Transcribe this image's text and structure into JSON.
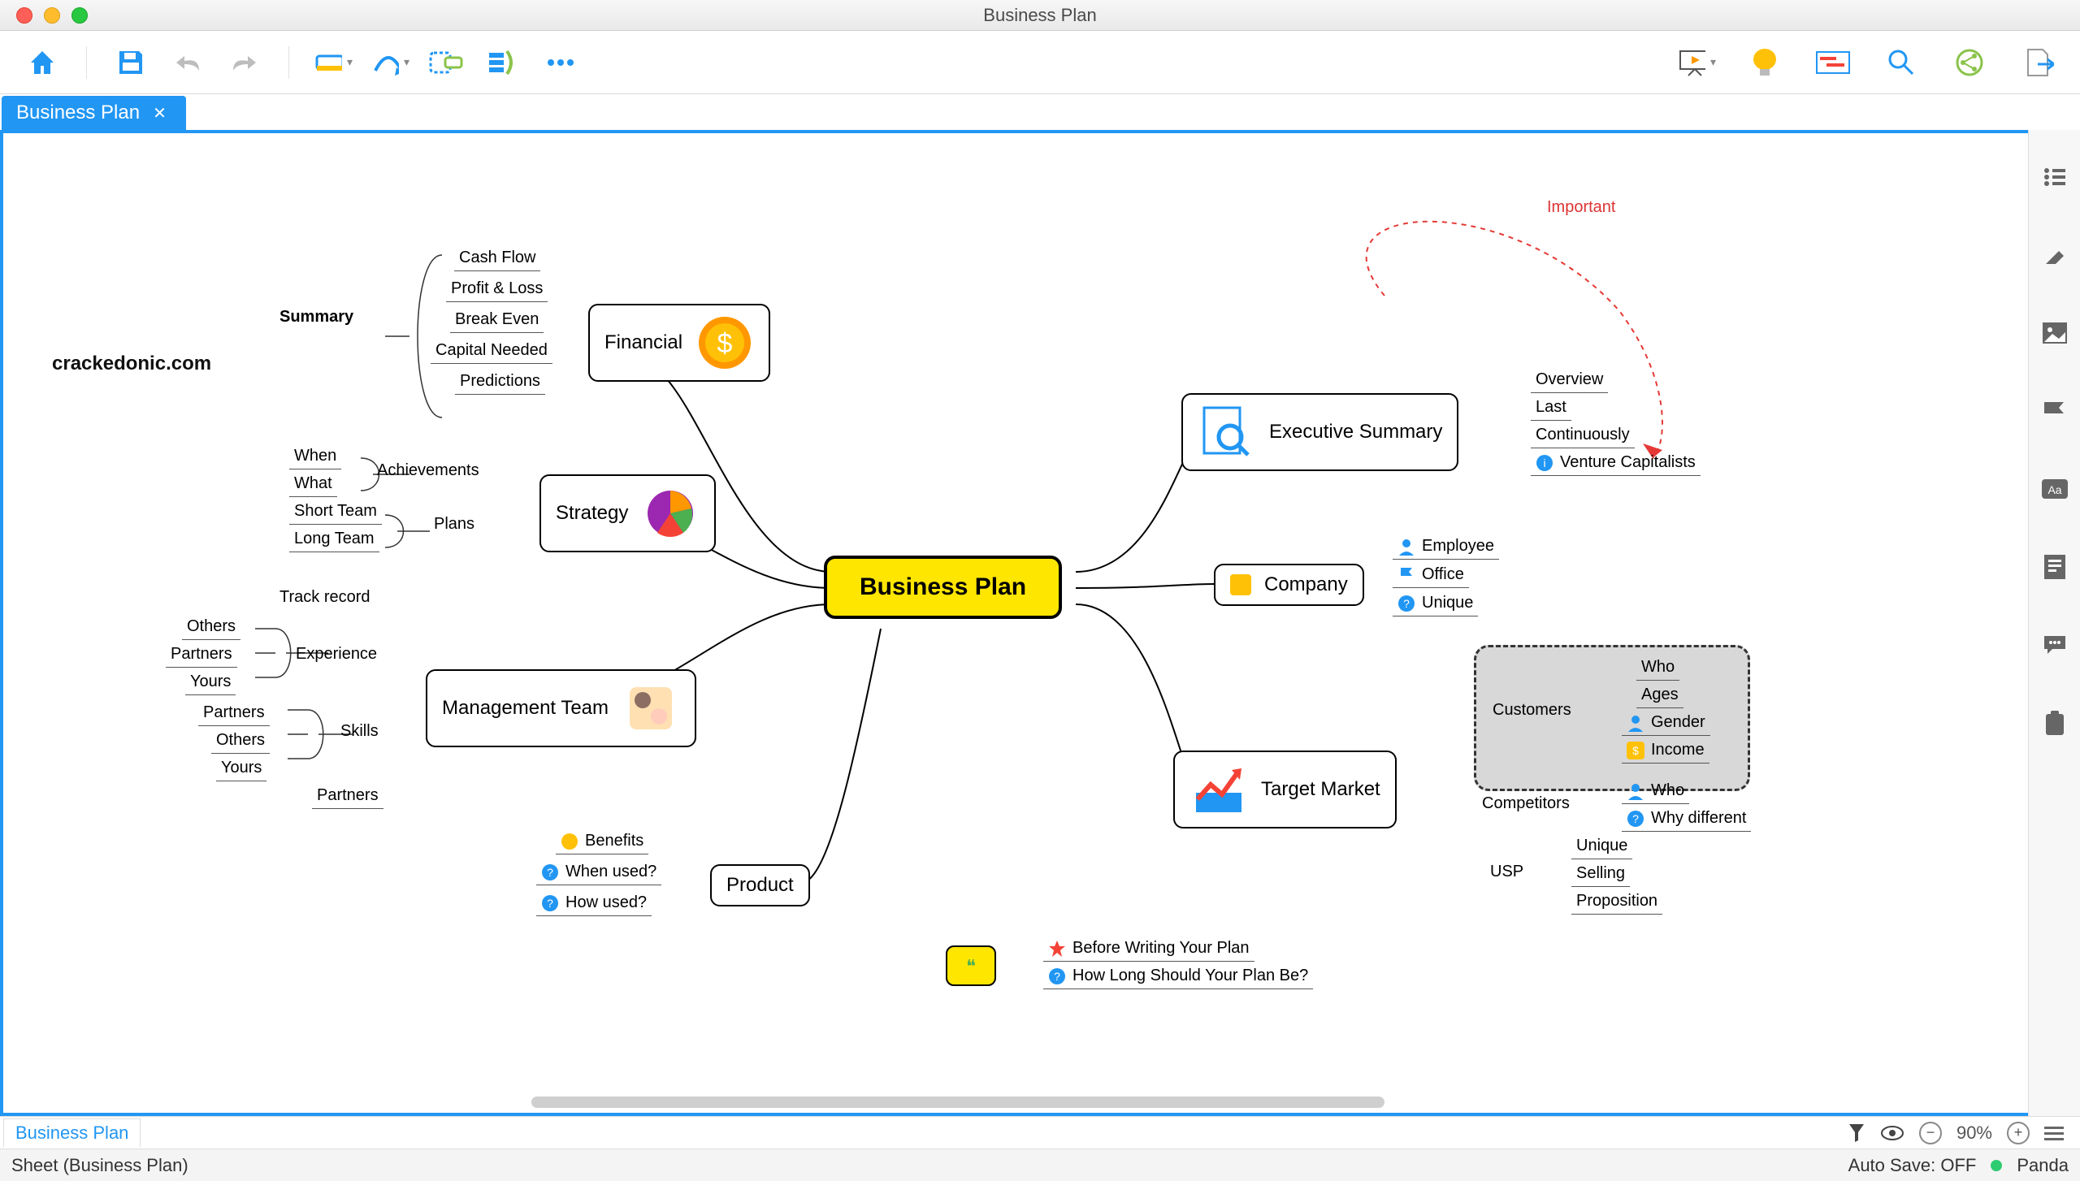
{
  "window": {
    "title": "Business Plan"
  },
  "tab": {
    "label": "Business Plan"
  },
  "sheet_tab": "Business Plan",
  "status": {
    "sheet": "Sheet (Business Plan)",
    "autosave": "Auto Save: OFF",
    "user": "Panda"
  },
  "zoom": {
    "pct": "90%"
  },
  "watermark": "crackedonic.com",
  "callout": "Important",
  "central": "Business Plan",
  "nodes": {
    "financial": "Financial",
    "strategy": "Strategy",
    "management": "Management Team",
    "product": "Product",
    "exec": "Executive Summary",
    "company": "Company",
    "target": "Target Market"
  },
  "groups": {
    "summary": "Summary",
    "achievements": "Achievements",
    "plans": "Plans",
    "trackrecord": "Track record",
    "experience": "Experience",
    "skills": "Skills",
    "partners_only": "Partners",
    "customers": "Customers",
    "competitors": "Competitors",
    "usp": "USP"
  },
  "financial_sub": [
    "Cash Flow",
    "Profit & Loss",
    "Break Even",
    "Capital Needed",
    "Predictions"
  ],
  "strategy_ach": [
    "When",
    "What"
  ],
  "strategy_plan": [
    "Short Team",
    "Long Team"
  ],
  "mgmt_exp": [
    "Others",
    "Partners",
    "Yours"
  ],
  "mgmt_skills": [
    "Partners",
    "Others",
    "Yours"
  ],
  "product_sub": [
    "Benefits",
    "When used?",
    "How used?"
  ],
  "exec_sub": [
    "Overview",
    "Last",
    "Continuously",
    "Venture Capitalists"
  ],
  "company_sub": [
    "Employee",
    "Office",
    "Unique"
  ],
  "customers_sub": [
    "Who",
    "Ages",
    "Gender",
    "Income"
  ],
  "competitors_sub": [
    "Who",
    "Why different"
  ],
  "usp_sub": [
    "Unique",
    "Selling",
    "Proposition"
  ],
  "floating": [
    "Before Writing Your Plan",
    "How Long Should Your Plan Be?"
  ]
}
